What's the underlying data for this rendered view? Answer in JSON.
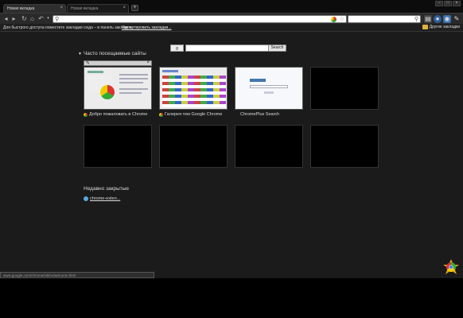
{
  "tabs": [
    {
      "label": "Новая вкладка",
      "active": true
    },
    {
      "label": "Новая вкладка",
      "active": false
    }
  ],
  "toolbar": {
    "omnibox_value": "",
    "search_value": ""
  },
  "bookmarks_bar": {
    "hint": "Для быстрого доступа поместите закладки сюда – в панель закладок.",
    "import_link": "Импортировать закладки...",
    "other_bookmarks": "Другие закладки"
  },
  "ntp": {
    "search_logo": "g",
    "search_button": "Search",
    "most_visited_title": "Часто посещаемые сайты",
    "thumbnails": [
      {
        "title": "Добро пожаловать в Chrome",
        "filled": true
      },
      {
        "title": "Галерея тем Google Chrome",
        "filled": true
      },
      {
        "title": "ChromePlus Search",
        "filled": true
      },
      {
        "title": "",
        "filled": false
      },
      {
        "title": "",
        "filled": false
      },
      {
        "title": "",
        "filled": false
      },
      {
        "title": "",
        "filled": false
      },
      {
        "title": "",
        "filled": false
      }
    ],
    "recently_closed_title": "Недавно закрытые",
    "recently_closed_items": [
      "chrome-exten..."
    ]
  },
  "status_bar": "www.google.com/chrome/intl/ru/welcome.html",
  "colors": {
    "background": "#1b1b1b",
    "text": "#dddddd",
    "omnibox": "#ffffff"
  }
}
